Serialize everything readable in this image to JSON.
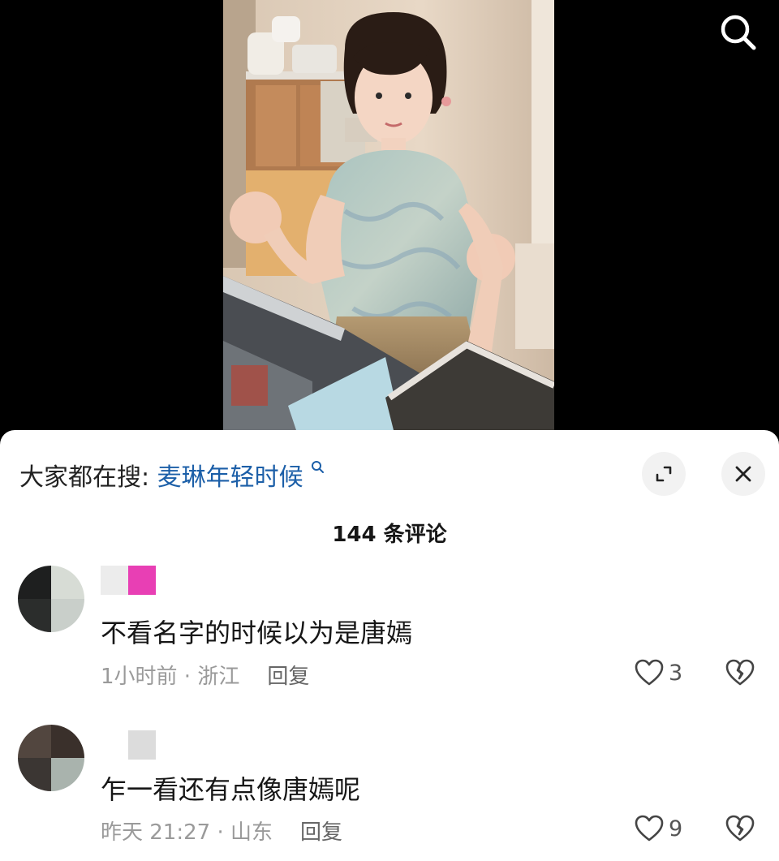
{
  "video": {
    "search_icon": "search-icon"
  },
  "panel": {
    "search_prefix": "大家都在搜:",
    "search_term": "麦琳年轻时候",
    "search_term_icon": "small-search-icon",
    "expand_icon": "expand-icon",
    "close_icon": "close-icon",
    "comment_count": "144 条评论"
  },
  "comments": [
    {
      "text": "不看名字的时候以为是唐嫣",
      "time": "1小时前 · 浙江",
      "reply": "回复",
      "likes": "3"
    },
    {
      "text": "乍一看还有点像唐嫣呢",
      "time": "昨天 21:27 · 山东",
      "reply": "回复",
      "likes": "9"
    }
  ],
  "colors": {
    "link": "#1c5fa8",
    "username_highlight": "#e83fb4"
  }
}
